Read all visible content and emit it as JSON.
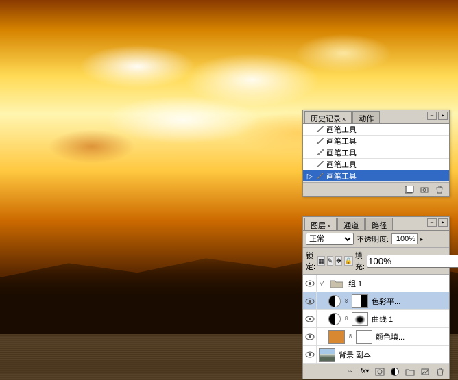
{
  "history_panel": {
    "tabs": [
      {
        "label": "历史记录",
        "active": true
      },
      {
        "label": "动作",
        "active": false
      }
    ],
    "items": [
      {
        "label": "画笔工具",
        "selected": false
      },
      {
        "label": "画笔工具",
        "selected": false
      },
      {
        "label": "画笔工具",
        "selected": false
      },
      {
        "label": "画笔工具",
        "selected": false
      },
      {
        "label": "画笔工具",
        "selected": true
      }
    ]
  },
  "layers_panel": {
    "tabs": [
      {
        "label": "图层",
        "active": true
      },
      {
        "label": "通道",
        "active": false
      },
      {
        "label": "路径",
        "active": false
      }
    ],
    "blend_mode": "正常",
    "opacity_label": "不透明度:",
    "opacity_value": "100%",
    "lock_label": "锁定:",
    "fill_label": "填充:",
    "fill_value": "100%",
    "layers": [
      {
        "type": "group",
        "name": "组 1",
        "visible": true,
        "expanded": true,
        "indent": 0,
        "selected": false
      },
      {
        "type": "adjustment",
        "name": "色彩平...",
        "visible": true,
        "indent": 1,
        "selected": true,
        "mask_bg": "linear-gradient(to right,#fff 55%,#000 55%)"
      },
      {
        "type": "adjustment",
        "name": "曲线 1",
        "visible": true,
        "indent": 1,
        "selected": false,
        "mask_bg": "radial-gradient(ellipse at 50% 55%,#000 20%,#fff 50%)"
      },
      {
        "type": "fill",
        "name": "颜色填...",
        "visible": true,
        "indent": 1,
        "selected": false,
        "fill_color": "#d88830",
        "mask_bg": "#fff"
      },
      {
        "type": "normal",
        "name": "背景 副本",
        "visible": true,
        "indent": 0,
        "selected": false,
        "thumb_bg": "linear-gradient(to bottom,#a8c8e8 45%,#d0d8d0 45%,#586858 75%)"
      }
    ]
  }
}
